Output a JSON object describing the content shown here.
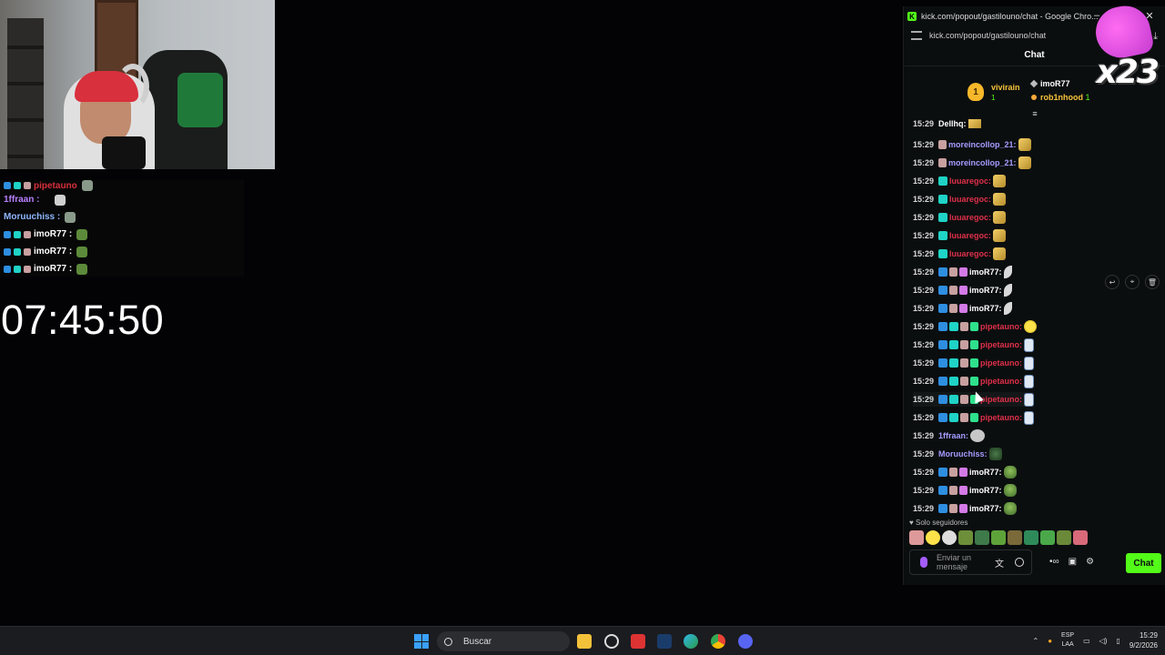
{
  "overlay": {
    "rows": [
      {
        "user": "pipetauno",
        "color": "#d8303c"
      },
      {
        "user": "1ffraan :",
        "color": "#b980ff"
      },
      {
        "user": "Moruuchiss :",
        "color": "#8fb7ff"
      },
      {
        "user": "imoR77 :",
        "color": "#ffffff"
      },
      {
        "user": "imoR77 :",
        "color": "#ffffff"
      },
      {
        "user": "imoR77 :",
        "color": "#ffffff"
      }
    ]
  },
  "timer": "07:45:50",
  "browser": {
    "title": "kick.com/popout/gastilouno/chat - Google Chro...",
    "url": "kick.com/popout/gastilouno/chat"
  },
  "chat": {
    "header": "Chat",
    "overlay_text": "x23",
    "gifters": {
      "rank": "1",
      "first": "vivirain",
      "first_count": "1",
      "second": "imoR77",
      "third": "rob1nhood",
      "third_count": "1"
    },
    "messages": [
      {
        "time": "15:29",
        "user": "Dellhq:",
        "color": "#ffffff",
        "badges": [],
        "emote": "clap"
      },
      {
        "time": "15:29",
        "user": "moreincollop_21:",
        "color": "#a59cff",
        "badges": [
          "ham"
        ],
        "emote": "clap"
      },
      {
        "time": "15:29",
        "user": "moreincollop_21:",
        "color": "#a59cff",
        "badges": [
          "ham"
        ],
        "emote": "clap"
      },
      {
        "time": "15:29",
        "user": "luuaregoc:",
        "color": "#e0304a",
        "badges": [
          "teal"
        ],
        "emote": "clap"
      },
      {
        "time": "15:29",
        "user": "luuaregoc:",
        "color": "#e0304a",
        "badges": [
          "teal"
        ],
        "emote": "clap"
      },
      {
        "time": "15:29",
        "user": "luuaregoc:",
        "color": "#e0304a",
        "badges": [
          "teal"
        ],
        "emote": "clap"
      },
      {
        "time": "15:29",
        "user": "luuaregoc:",
        "color": "#e0304a",
        "badges": [
          "teal"
        ],
        "emote": "clap"
      },
      {
        "time": "15:29",
        "user": "luuaregoc:",
        "color": "#e0304a",
        "badges": [
          "teal"
        ],
        "emote": "clap"
      },
      {
        "time": "15:29",
        "user": "imoR77:",
        "color": "#ffffff",
        "badges": [
          "blue",
          "ham",
          "sub"
        ],
        "emote": "feather"
      },
      {
        "time": "15:29",
        "user": "imoR77:",
        "color": "#ffffff",
        "badges": [
          "blue",
          "ham",
          "sub"
        ],
        "emote": "feather"
      },
      {
        "time": "15:29",
        "user": "imoR77:",
        "color": "#ffffff",
        "badges": [
          "blue",
          "ham",
          "sub"
        ],
        "emote": "feather"
      },
      {
        "time": "15:29",
        "user": "pipetauno:",
        "color": "#e0304a",
        "badges": [
          "blue",
          "teal",
          "ham",
          "gift"
        ],
        "emote": "yellow"
      },
      {
        "time": "15:29",
        "user": "pipetauno:",
        "color": "#e0304a",
        "badges": [
          "blue",
          "teal",
          "ham",
          "gift"
        ],
        "emote": "blue"
      },
      {
        "time": "15:29",
        "user": "pipetauno:",
        "color": "#e0304a",
        "badges": [
          "blue",
          "teal",
          "ham",
          "gift"
        ],
        "emote": "blue"
      },
      {
        "time": "15:29",
        "user": "pipetauno:",
        "color": "#e0304a",
        "badges": [
          "blue",
          "teal",
          "ham",
          "gift"
        ],
        "emote": "blue"
      },
      {
        "time": "15:29",
        "user": "pipetauno:",
        "color": "#e0304a",
        "badges": [
          "blue",
          "teal",
          "ham",
          "gift"
        ],
        "emote": "blue"
      },
      {
        "time": "15:29",
        "user": "pipetauno:",
        "color": "#e0304a",
        "badges": [
          "blue",
          "teal",
          "ham",
          "gift"
        ],
        "emote": "blue"
      },
      {
        "time": "15:29",
        "user": "1ffraan:",
        "color": "#a59cff",
        "badges": [],
        "emote": "cat"
      },
      {
        "time": "15:29",
        "user": "Moruuchiss:",
        "color": "#a59cff",
        "badges": [],
        "emote": "green"
      },
      {
        "time": "15:29",
        "user": "imoR77:",
        "color": "#ffffff",
        "badges": [
          "blue",
          "ham",
          "sub"
        ],
        "emote": "frog"
      },
      {
        "time": "15:29",
        "user": "imoR77:",
        "color": "#ffffff",
        "badges": [
          "blue",
          "ham",
          "sub"
        ],
        "emote": "frog"
      },
      {
        "time": "15:29",
        "user": "imoR77:",
        "color": "#ffffff",
        "badges": [
          "blue",
          "ham",
          "sub"
        ],
        "emote": "frog"
      }
    ],
    "followers_only": "Solo seguidores",
    "input_placeholder": "Enviar un mensaje",
    "send_label": "Chat"
  },
  "taskbar": {
    "search": "Buscar",
    "lang_1": "ESP",
    "lang_2": "LAA",
    "time": "15:29",
    "date": "9/2/2026"
  }
}
